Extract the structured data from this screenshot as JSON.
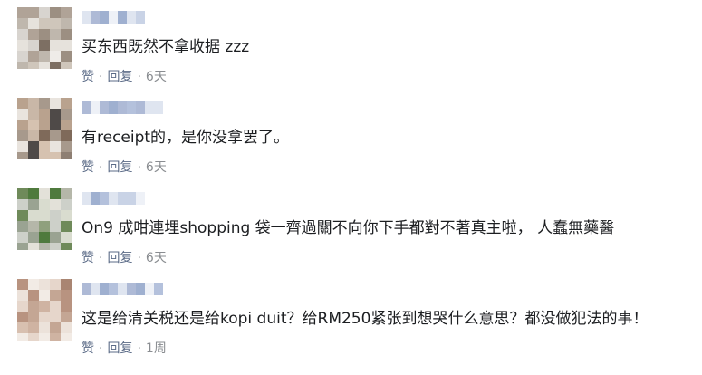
{
  "comments": [
    {
      "text": "买东西既然不拿收据 zzz",
      "like": "赞",
      "reply": "回复",
      "time": "6天",
      "sep": "·"
    },
    {
      "text": "有receipt的，是你没拿罢了。",
      "like": "赞",
      "reply": "回复",
      "time": "6天",
      "sep": "·"
    },
    {
      "text": "On9 成咁連埋shopping 袋一齊過關不向你下手都對不著真主啦， 人蠢無藥醫",
      "like": "赞",
      "reply": "回复",
      "time": "6天",
      "sep": "·"
    },
    {
      "text": "这是给清关税还是给kopi duit？给RM250紧张到想哭什么意思？都没做犯法的事！",
      "like": "赞",
      "reply": "回复",
      "time": "1周",
      "sep": "·"
    }
  ],
  "colors": {
    "text": "#1c1e21",
    "action": "#5b6b87",
    "muted": "#8a8d91"
  }
}
